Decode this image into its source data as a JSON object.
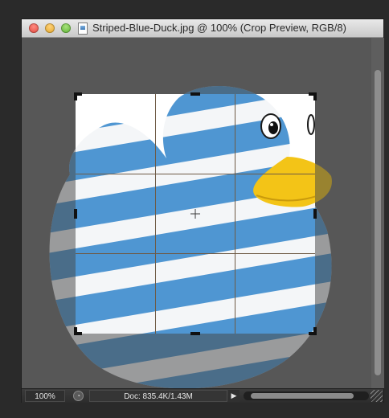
{
  "window": {
    "title": "Striped-Blue-Duck.jpg @ 100% (Crop Preview, RGB/8)"
  },
  "statusbar": {
    "zoom": "100%",
    "doc_info": "Doc: 835.4K/1.43M",
    "arrow": "▶"
  },
  "colors": {
    "duck_blue": "#4f96d2",
    "stripe_white": "#f4f6f8",
    "beak_yellow": "#f3c417",
    "overlay_gray": "#6a6a6a"
  },
  "icons": {
    "close": "close-icon",
    "minimize": "minimize-icon",
    "maximize": "maximize-icon",
    "document": "document-icon",
    "status": "timer-icon",
    "arrow": "triangle-right-icon"
  }
}
